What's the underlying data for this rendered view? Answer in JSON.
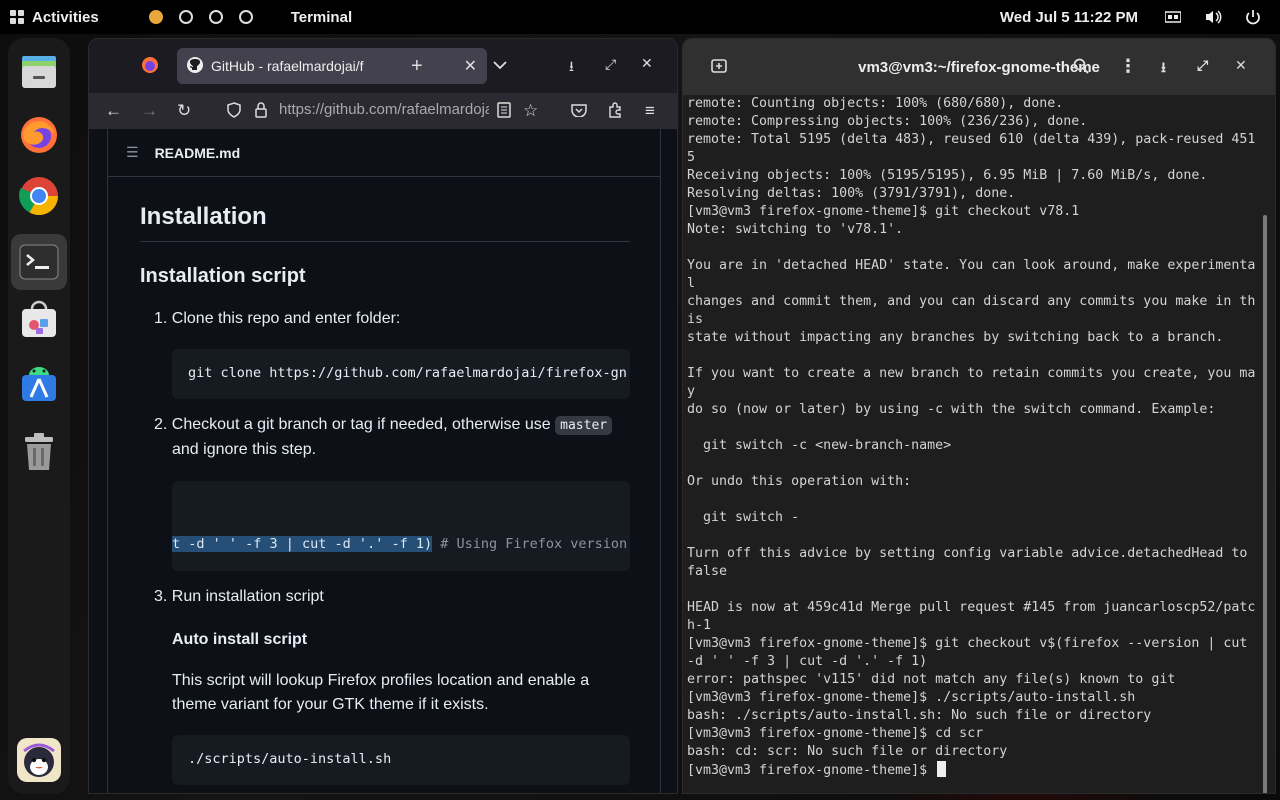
{
  "topbar": {
    "activities": "Activities",
    "app_name": "Terminal",
    "clock": "Wed Jul 5  11:22 PM"
  },
  "dock": {
    "items": [
      "files-icon",
      "firefox-icon",
      "chrome-icon",
      "terminal-icon",
      "software-icon",
      "android-studio-icon",
      "trash-icon",
      "app-grid-icon"
    ]
  },
  "firefox": {
    "tab_title": "GitHub - rafaelmardojai/f",
    "url": "https://github.com/rafaelmardojai/firefox-gnome-theme",
    "readme_label": "README.md",
    "h1": "Installation",
    "h2": "Installation script",
    "step1": "1.  Clone this repo and enter folder:",
    "code1": "git clone https://github.com/rafaelmardojai/firefox-gn",
    "step2_a": "2.  Checkout a git branch or tag if needed, otherwise use",
    "step2_code": "master",
    "step2_b": "and ignore this step.",
    "code2_sel": "t -d ' ' -f 3 | cut -d '.' -f 1)",
    "code2_comment": " # Using Firefox version",
    "step3": "3.  Run installation script",
    "h3": "Auto install script",
    "para_line1": "This script will lookup Firefox profiles location and enable a",
    "para_line2": "theme variant for your GTK theme if it exists.",
    "code3": "./scripts/auto-install.sh"
  },
  "terminal": {
    "title": "vm3@vm3:~/firefox-gnome-theme",
    "lines": [
      "remote: Counting objects: 100% (680/680), done.",
      "remote: Compressing objects: 100% (236/236), done.",
      "remote: Total 5195 (delta 483), reused 610 (delta 439), pack-reused 451",
      "5",
      "Receiving objects: 100% (5195/5195), 6.95 MiB | 7.60 MiB/s, done.",
      "Resolving deltas: 100% (3791/3791), done.",
      "[vm3@vm3 firefox-gnome-theme]$ git checkout v78.1",
      "Note: switching to 'v78.1'.",
      "",
      "You are in 'detached HEAD' state. You can look around, make experimenta",
      "l",
      "changes and commit them, and you can discard any commits you make in th",
      "is",
      "state without impacting any branches by switching back to a branch.",
      "",
      "If you want to create a new branch to retain commits you create, you ma",
      "y",
      "do so (now or later) by using -c with the switch command. Example:",
      "",
      "  git switch -c <new-branch-name>",
      "",
      "Or undo this operation with:",
      "",
      "  git switch -",
      "",
      "Turn off this advice by setting config variable advice.detachedHead to",
      "false",
      "",
      "HEAD is now at 459c41d Merge pull request #145 from juancarloscp52/patc",
      "h-1",
      "[vm3@vm3 firefox-gnome-theme]$ git checkout v$(firefox --version | cut",
      "-d ' ' -f 3 | cut -d '.' -f 1)",
      "error: pathspec 'v115' did not match any file(s) known to git",
      "[vm3@vm3 firefox-gnome-theme]$ ./scripts/auto-install.sh",
      "bash: ./scripts/auto-install.sh: No such file or directory",
      "[vm3@vm3 firefox-gnome-theme]$ cd scr",
      "bash: cd: scr: No such file or directory"
    ],
    "prompt": "[vm3@vm3 firefox-gnome-theme]$ "
  }
}
